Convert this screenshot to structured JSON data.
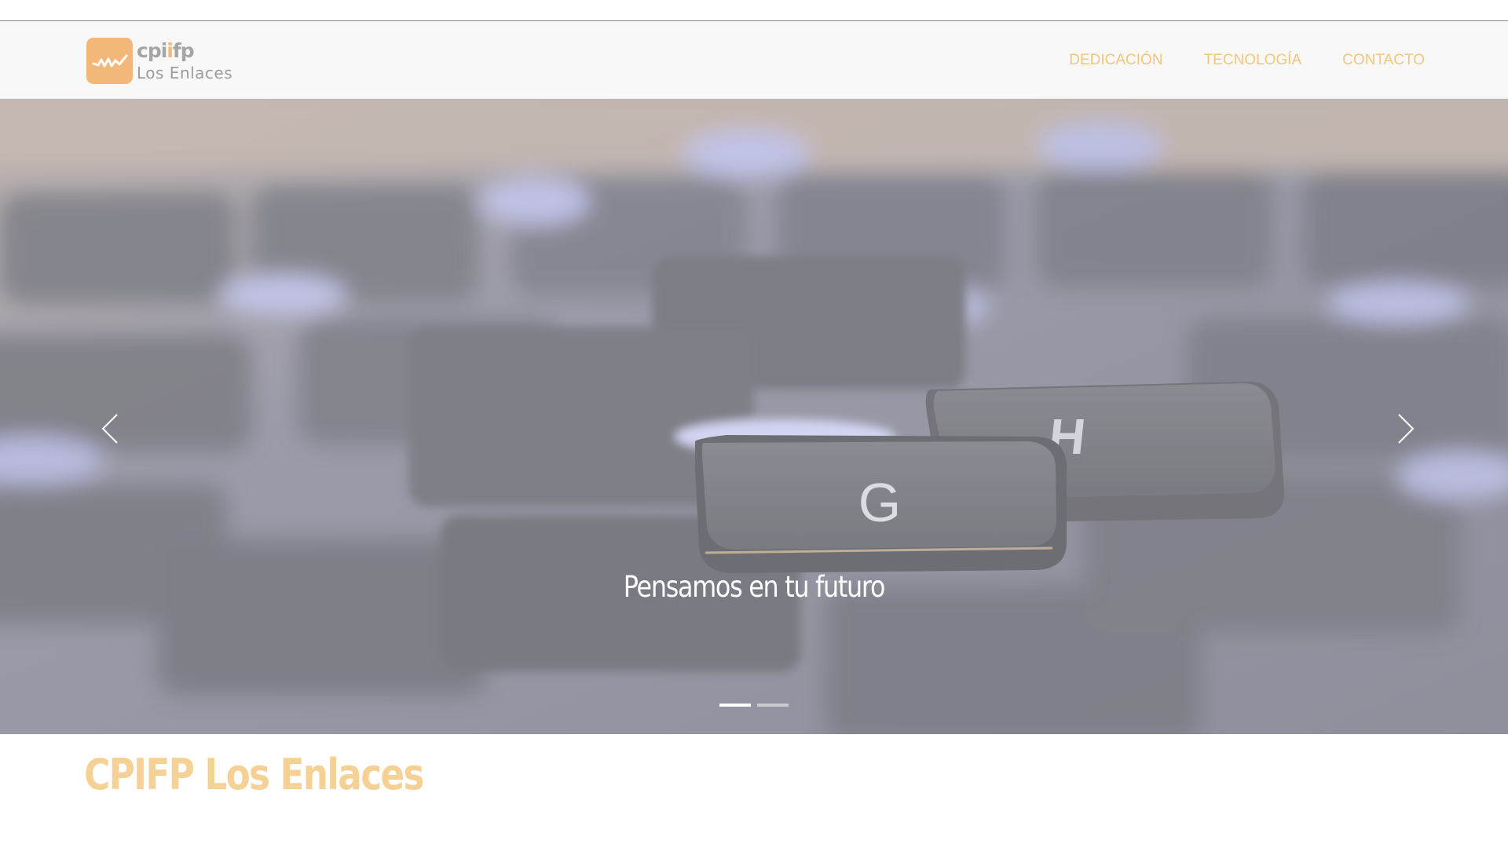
{
  "site": {
    "logo_top": "cpi",
    "logo_top_dot": "i",
    "logo_top_end": "fp",
    "logo_bottom": "Los Enlaces"
  },
  "nav": {
    "items": [
      {
        "label": "DEDICACIÓN"
      },
      {
        "label": "TECNOLOGÍA"
      },
      {
        "label": "CONTACTO"
      }
    ]
  },
  "hero": {
    "caption": "Pensamos en tu futuro",
    "slide_count": 2,
    "active_slide": 1
  },
  "main": {
    "heading": "CPIFP Los Enlaces"
  },
  "colors": {
    "accent": "#f5c57a",
    "logo_orange": "#f3b77a",
    "heading": "#f5d195"
  },
  "icons": {
    "prev": "chevron-left-icon",
    "next": "chevron-right-icon"
  }
}
